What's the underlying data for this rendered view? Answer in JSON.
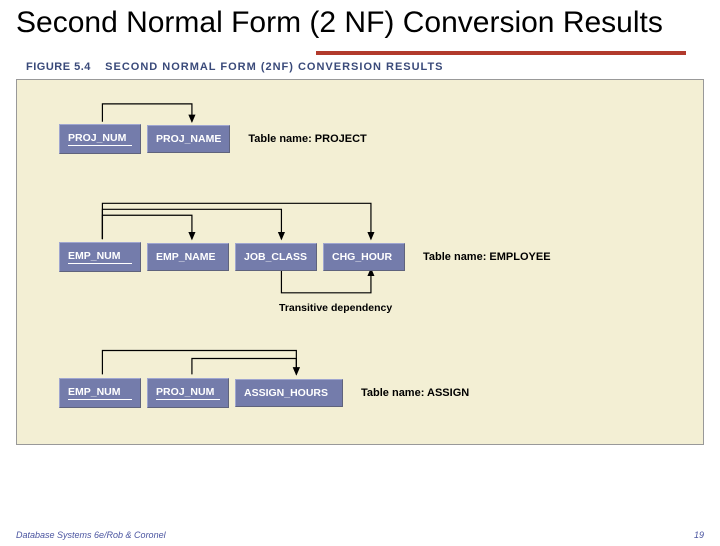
{
  "slide": {
    "title": "Second Normal Form (2 NF) Conversion Results",
    "figure_label_num": "FIGURE 5.4",
    "figure_label_title": "SECOND NORMAL FORM (2NF) CONVERSION RESULTS",
    "footer_left": "Database Systems 6e/Rob & Coronel",
    "footer_right": "19"
  },
  "tables": {
    "project": {
      "name": "Table name: PROJECT",
      "cols": [
        "PROJ_NUM",
        "PROJ_NAME"
      ],
      "keys": [
        true,
        false
      ]
    },
    "employee": {
      "name": "Table name: EMPLOYEE",
      "cols": [
        "EMP_NUM",
        "EMP_NAME",
        "JOB_CLASS",
        "CHG_HOUR"
      ],
      "keys": [
        true,
        false,
        false,
        false
      ]
    },
    "assign": {
      "name": "Table name: ASSIGN",
      "cols": [
        "EMP_NUM",
        "PROJ_NUM",
        "ASSIGN_HOURS"
      ],
      "keys": [
        true,
        true,
        false
      ]
    }
  },
  "labels": {
    "transitive": "Transitive dependency"
  }
}
